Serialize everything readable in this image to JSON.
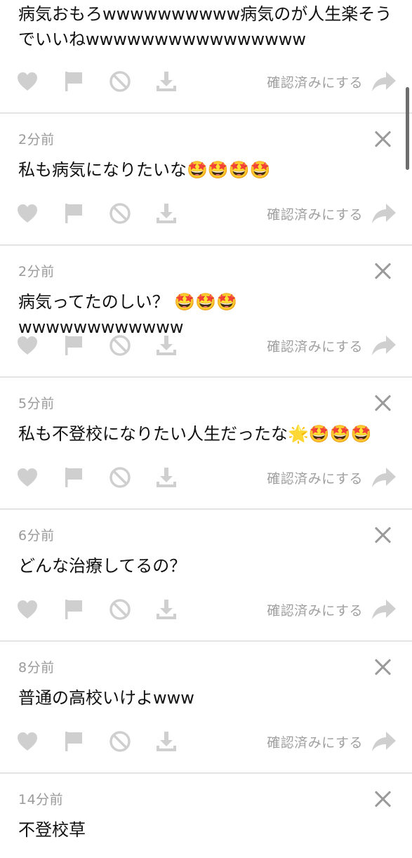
{
  "confirm_label": "確認済みにする",
  "icon_color": "#cfcfcf",
  "posts": [
    {
      "time": "",
      "text": "病気おもろwwwwwwwwww病気のが人生楽そうでいいねwwwwwwwwwwwwwwww"
    },
    {
      "time": "2分前",
      "text": "私も病気になりたいな🤩🤩🤩🤩"
    },
    {
      "time": "2分前",
      "text": "病気ってたのしい？ 🤩🤩🤩wwwwwwwwwwww"
    },
    {
      "time": "5分前",
      "text": "私も不登校になりたい人生だったな🌟🤩🤩🤩"
    },
    {
      "time": "6分前",
      "text": "どんな治療してるの？"
    },
    {
      "time": "8分前",
      "text": "普通の高校いけよwww"
    },
    {
      "time": "14分前",
      "text": "不登校草"
    }
  ]
}
